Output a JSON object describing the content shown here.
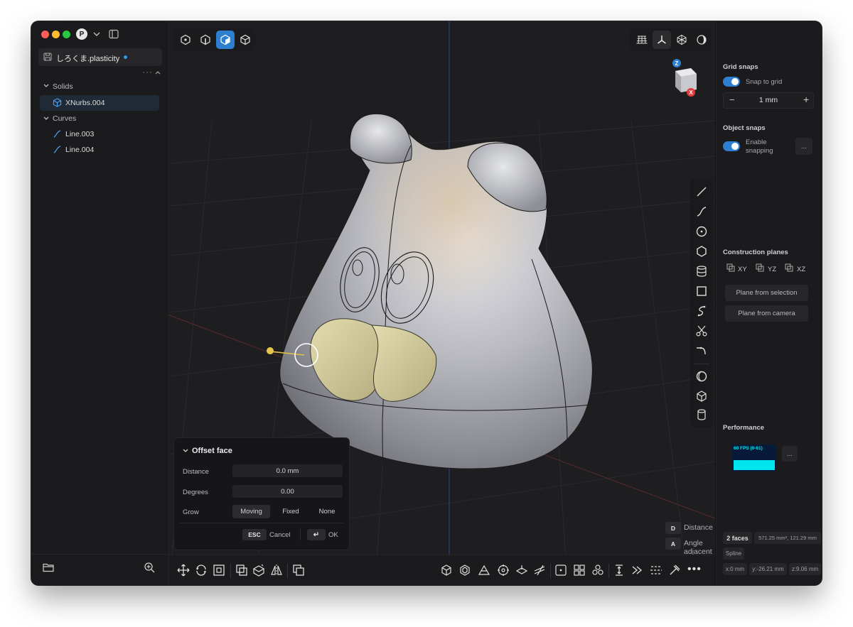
{
  "sidebar": {
    "profile_initial": "P",
    "file_tab": "しろくま.plasticity",
    "sections": {
      "solids_label": "Solids",
      "curves_label": "Curves"
    },
    "items": {
      "solid_1": "XNurbs.004",
      "curve_1": "Line.003",
      "curve_2": "Line.004"
    }
  },
  "viewcube": {
    "z_label": "Z",
    "x_label": "X"
  },
  "dialog": {
    "title": "Offset face",
    "distance_label": "Distance",
    "distance_value": "0.0 mm",
    "degrees_label": "Degrees",
    "degrees_value": "0.00",
    "grow_label": "Grow",
    "grow_options": [
      "Moving",
      "Fixed",
      "None"
    ],
    "grow_selected": "Moving",
    "esc_key": "ESC",
    "cancel_label": "Cancel",
    "enter_key": "↵",
    "ok_label": "OK"
  },
  "hints": {
    "d_key": "D",
    "d_label": "Distance",
    "a_key": "A",
    "a_label": "Angle adjacent"
  },
  "right_panel": {
    "grid_snaps_title": "Grid snaps",
    "snap_to_grid_label": "Snap to grid",
    "snap_to_grid_on": true,
    "grid_value": "1 mm",
    "object_snaps_title": "Object snaps",
    "enable_snapping_label": "Enable snapping",
    "enable_snapping_on": true,
    "more_label": "...",
    "construction_planes_title": "Construction planes",
    "planes": [
      "XY",
      "YZ",
      "XZ"
    ],
    "plane_from_selection": "Plane from selection",
    "plane_from_camera": "Plane from camera",
    "performance_title": "Performance",
    "fps_label": "60 FPS (0-61)",
    "selection_count": "2 faces",
    "selection_area": "571.25 mm², 121.29 mm",
    "selection_type": "Spline",
    "coord_x": "x:0 mm",
    "coord_y": "y:-26.21 mm",
    "coord_z": "z:9.06 mm"
  },
  "colors": {
    "accent": "#2f7fd1",
    "window_bg": "#141416",
    "panel_bg": "#1b1b1d",
    "viewport_bg": "#1e1e20",
    "fps_graph": "#00e5f0",
    "selection_face": "#d8cf9a",
    "close": "#ff5f57",
    "minimize": "#febc2e",
    "maximize": "#28c840"
  }
}
